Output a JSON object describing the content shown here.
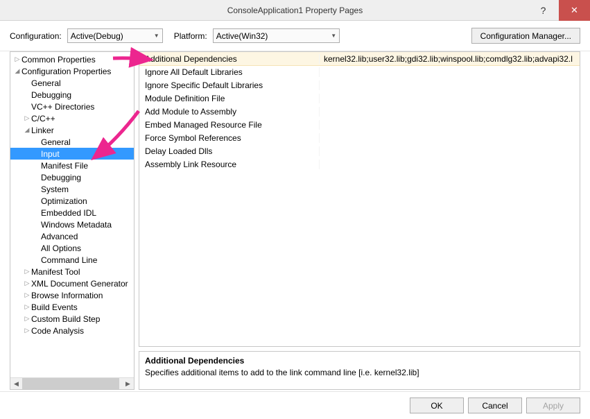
{
  "window": {
    "title": "ConsoleApplication1 Property Pages"
  },
  "configRow": {
    "configurationLabel": "Configuration:",
    "configurationValue": "Active(Debug)",
    "platformLabel": "Platform:",
    "platformValue": "Active(Win32)",
    "managerButton": "Configuration Manager..."
  },
  "tree": {
    "common": "Common Properties",
    "configProps": "Configuration Properties",
    "general": "General",
    "debugging": "Debugging",
    "vcpp": "VC++ Directories",
    "ccpp": "C/C++",
    "linker": "Linker",
    "linkerGeneral": "General",
    "linkerInput": "Input",
    "linkerManifest": "Manifest File",
    "linkerDebugging": "Debugging",
    "linkerSystem": "System",
    "linkerOptimization": "Optimization",
    "linkerEmbeddedIDL": "Embedded IDL",
    "linkerWinMeta": "Windows Metadata",
    "linkerAdvanced": "Advanced",
    "linkerAllOptions": "All Options",
    "linkerCmdLine": "Command Line",
    "manifestTool": "Manifest Tool",
    "xmlDoc": "XML Document Generator",
    "browseInfo": "Browse Information",
    "buildEvents": "Build Events",
    "customBuild": "Custom Build Step",
    "codeAnalysis": "Code Analysis"
  },
  "properties": [
    {
      "name": "Additional Dependencies",
      "value": "kernel32.lib;user32.lib;gdi32.lib;winspool.lib;comdlg32.lib;advapi32.l",
      "selected": true
    },
    {
      "name": "Ignore All Default Libraries",
      "value": ""
    },
    {
      "name": "Ignore Specific Default Libraries",
      "value": ""
    },
    {
      "name": "Module Definition File",
      "value": ""
    },
    {
      "name": "Add Module to Assembly",
      "value": ""
    },
    {
      "name": "Embed Managed Resource File",
      "value": ""
    },
    {
      "name": "Force Symbol References",
      "value": ""
    },
    {
      "name": "Delay Loaded Dlls",
      "value": ""
    },
    {
      "name": "Assembly Link Resource",
      "value": ""
    }
  ],
  "description": {
    "title": "Additional Dependencies",
    "text": "Specifies additional items to add to the link command line [i.e. kernel32.lib]"
  },
  "footer": {
    "ok": "OK",
    "cancel": "Cancel",
    "apply": "Apply"
  }
}
